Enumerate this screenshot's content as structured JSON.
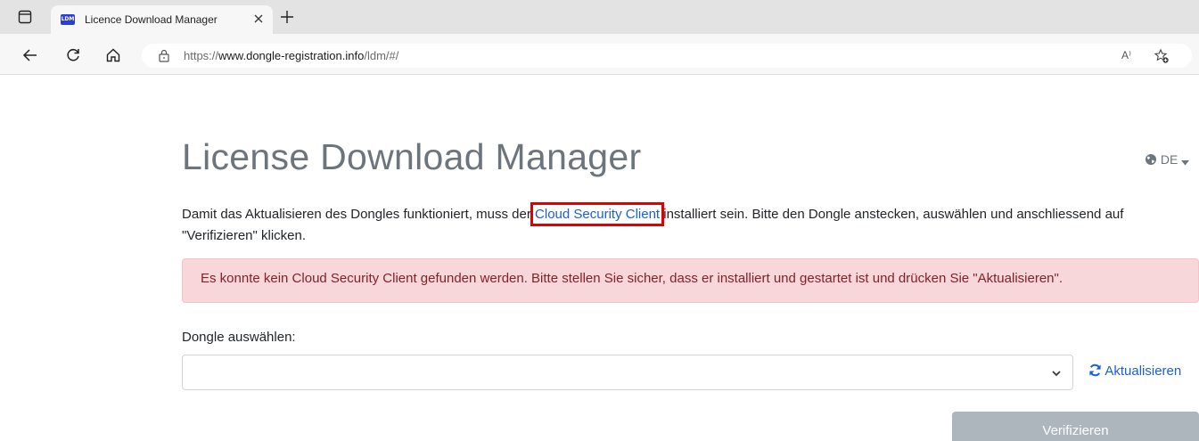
{
  "browser": {
    "tab": {
      "favicon_text": "LDM",
      "title": "Licence Download Manager"
    },
    "url_prefix": "https://",
    "url_domain": "www.dongle-registration.info",
    "url_path": "/ldm/#/",
    "read_aloud_label": "A⁾"
  },
  "page": {
    "title": "License Download Manager",
    "language": "DE",
    "intro_before_link": "Damit das Aktualisieren des Dongles funktioniert, muss der ",
    "intro_link": "Cloud Security Client",
    "intro_after_link": " installiert sein. Bitte den Dongle anstecken, auswählen und anschliessend auf \"Verifizieren\" klicken.",
    "alert": "Es konnte kein Cloud Security Client gefunden werden. Bitte stellen Sie sicher, dass er installiert und gestartet ist und drücken Sie \"Aktualisieren\".",
    "select_label": "Dongle auswählen:",
    "select_value": "",
    "refresh_label": "Aktualisieren",
    "verify_button": "Verifizieren"
  },
  "colors": {
    "accent_link": "#1a5fd6",
    "alert_bg": "#f8d7da",
    "alert_text": "#842029",
    "highlight_box": "#e00000",
    "button_disabled": "#adb5bd"
  }
}
